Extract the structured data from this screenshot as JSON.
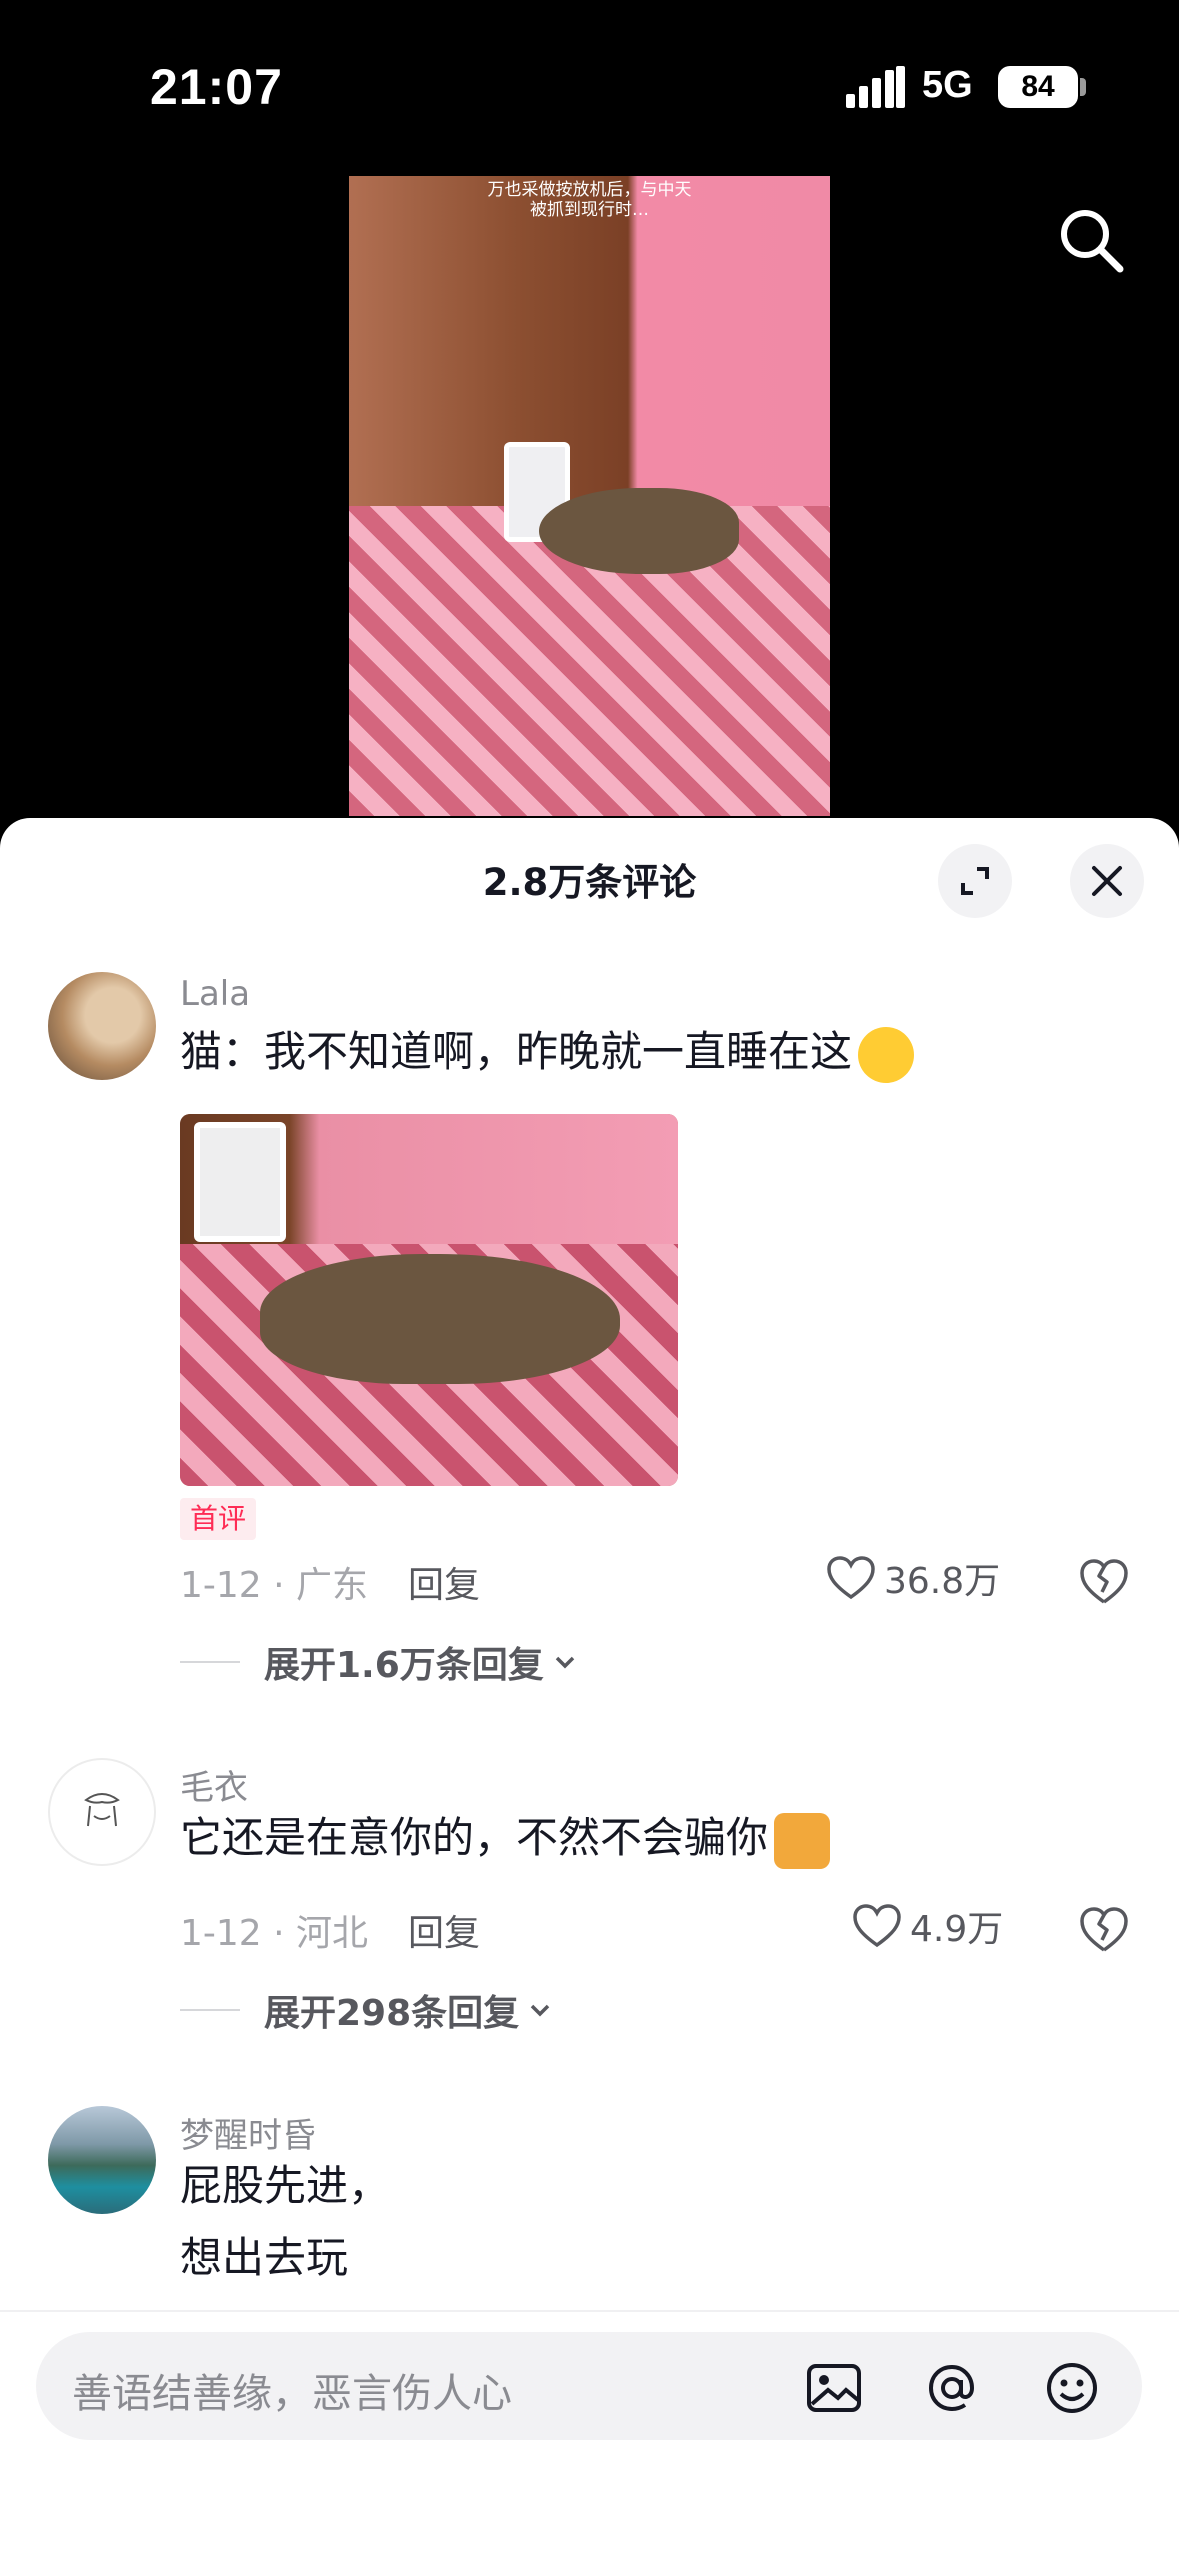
{
  "status_bar": {
    "time": "21:07",
    "network": "5G",
    "battery": "84"
  },
  "video": {
    "caption_line1": "万也采做按放机后，与中天",
    "caption_line2": "被抓到现行时…"
  },
  "sheet": {
    "title": "2.8万条评论"
  },
  "comments": [
    {
      "username": "Lala",
      "text": "猫：我不知道啊，昨晚就一直睡在这",
      "badge": "首评",
      "meta": "1-12 · 广东",
      "reply_label": "回复",
      "likes": "36.8万",
      "expand_label": "展开1.6万条回复"
    },
    {
      "username": "毛衣",
      "text": "它还是在意你的，不然不会骗你",
      "meta": "1-12 · 河北",
      "reply_label": "回复",
      "likes": "4.9万",
      "expand_label": "展开298条回复"
    },
    {
      "username": "梦醒时昏",
      "text_line1": "屁股先进，",
      "text_line2": "想出去玩"
    }
  ],
  "input": {
    "placeholder": "善语结善缘，恶言伤人心"
  },
  "colors": {
    "accent_red": "#fe2c55",
    "sheet_bg": "#ffffff",
    "page_bg": "#000000"
  }
}
